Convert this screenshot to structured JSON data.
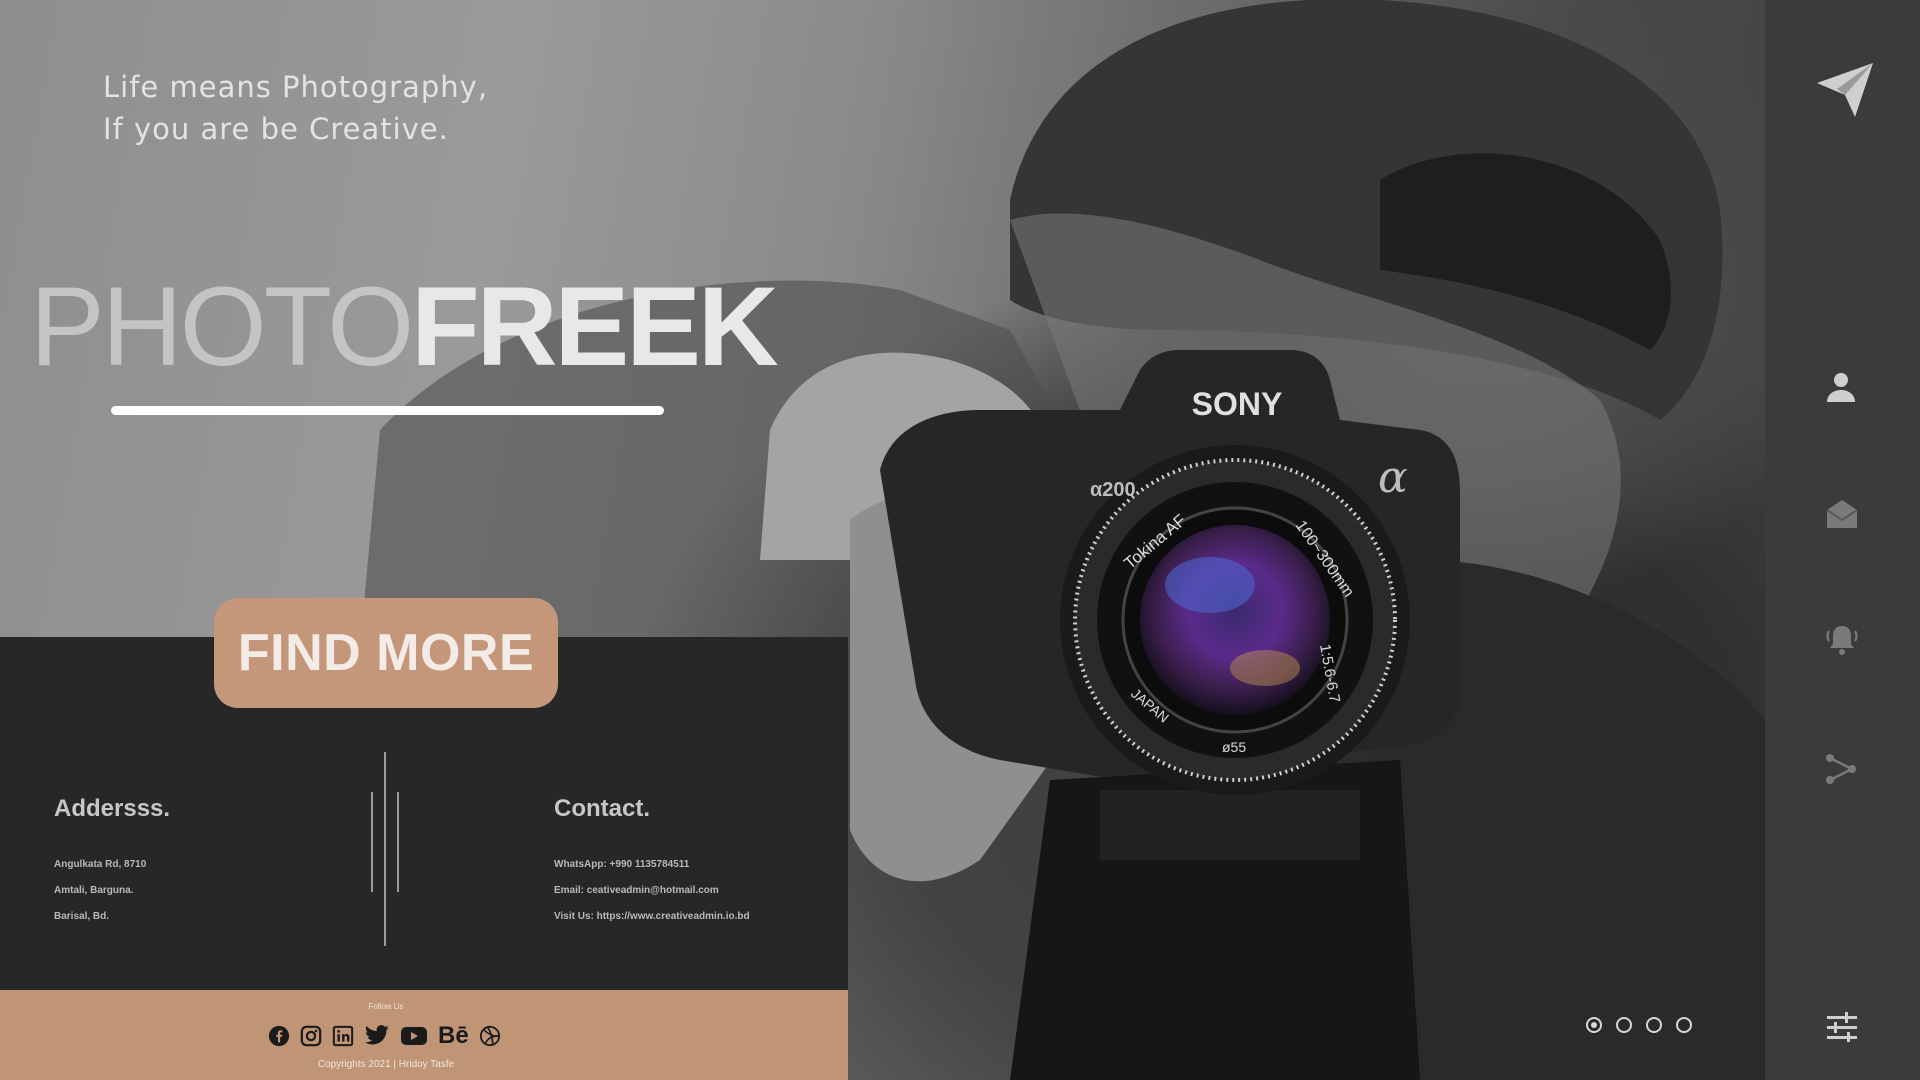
{
  "hero": {
    "tagline_line1": "Life means Photography,",
    "tagline_line2": "If you are be Creative.",
    "brand_light": "PHOTO",
    "brand_bold": "FREEK",
    "cta_label": "FIND MORE"
  },
  "camera": {
    "brand": "SONY",
    "model": "α200",
    "alpha_symbol": "α",
    "lens_text_1": "Tokina  AF",
    "lens_text_2": "100~300mm",
    "lens_text_3": "1:5.6-6.7",
    "lens_text_4": "JAPAN",
    "lens_text_5": "ø55"
  },
  "address": {
    "title": "Addersss.",
    "lines": [
      "Angulkata Rd, 8710",
      "Amtali, Barguna.",
      "Barisal, Bd."
    ]
  },
  "contact": {
    "title": "Contact.",
    "lines": [
      "WhatsApp: +990 1135784511",
      "Email: ceativeadmin@hotmail.com",
      "Visit Us: https://www.creativeadmin.io.bd"
    ]
  },
  "footer": {
    "follow_label": "Follow Us",
    "social_icons": [
      "facebook-icon",
      "instagram-icon",
      "linkedin-icon",
      "twitter-icon",
      "youtube-icon",
      "behance-icon",
      "dribbble-icon"
    ],
    "behance_text": "Bē",
    "copyright": "Copyrights 2021 | Hridoy Tasfe"
  },
  "sidebar": {
    "icons": [
      "send-icon",
      "user-icon",
      "mail-icon",
      "bell-icon",
      "share-icon",
      "settings-sliders-icon"
    ]
  },
  "slider": {
    "count": 4,
    "active_index": 0
  },
  "colors": {
    "accent": "#c4977a",
    "footer_bg": "#bf9576",
    "panel_bg": "#272727",
    "sidebar_bg": "#3b3b3b"
  }
}
